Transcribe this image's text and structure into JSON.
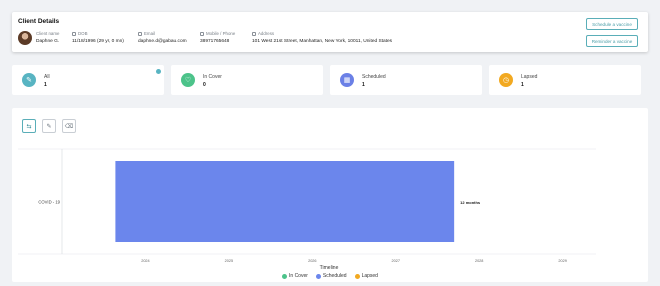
{
  "client": {
    "title": "Client Details",
    "name_label": "Client name",
    "name": "Daphne G.",
    "dob_label": "DOB",
    "dob": "11/18/1996 (29 yr, 0 mn)",
    "email_label": "Email",
    "email": "daphne.d@gabau.com",
    "phone_label": "Mobile / Phone",
    "phone": "38971765648",
    "address_label": "Address",
    "address": "101 West 21st Street, Manhattan, New York, 10011, United States",
    "schedule_button": "Schedule a vaccine",
    "reminder_button": "Reminder a vaccine"
  },
  "stats": [
    {
      "label": "All",
      "count": "1",
      "icon": "pencil-icon",
      "color": "#58b4c2"
    },
    {
      "label": "In Cover",
      "count": "0",
      "icon": "shield-icon",
      "color": "#4cc38a"
    },
    {
      "label": "Scheduled",
      "count": "1",
      "icon": "calendar-icon",
      "color": "#6b80e6"
    },
    {
      "label": "Lapsed",
      "count": "1",
      "icon": "clock-icon",
      "color": "#f2a921"
    }
  ],
  "toolbar": {
    "tools": [
      {
        "name": "chart-view-icon",
        "glyph": "⇆"
      },
      {
        "name": "edit-icon",
        "glyph": "✎"
      },
      {
        "name": "delete-icon",
        "glyph": "🗑"
      }
    ]
  },
  "chart_data": {
    "type": "bar",
    "orientation": "horizontal",
    "categories": [
      "COVID - 19"
    ],
    "x_ticks": [
      "2024",
      "2025",
      "2026",
      "2027",
      "2028",
      "2029"
    ],
    "xlabel": "Timeline",
    "series": [
      {
        "name": "In Cover",
        "color": "#4cc38a",
        "bars": []
      },
      {
        "name": "Scheduled",
        "color": "#6b86ec",
        "bars": [
          {
            "category": "COVID - 19",
            "start": 2023.64,
            "end": 2027.7,
            "label": "12 months"
          }
        ]
      },
      {
        "name": "Lapsed",
        "color": "#f2a921",
        "bars": []
      }
    ],
    "xlim": [
      2023.0,
      2029.4
    ],
    "grid": true,
    "legend": "bottom"
  }
}
